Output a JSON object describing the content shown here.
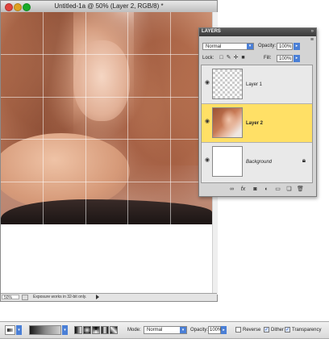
{
  "document": {
    "title": "Untitled-1a @ 50% (Layer 2, RGB/8) *",
    "status": {
      "zoom": "50%",
      "message": "Exposure works in 32-bit only."
    }
  },
  "layers_panel": {
    "title": "LAYERS",
    "blend_mode": "Normal",
    "opacity_label": "Opacity:",
    "opacity_value": "100%",
    "lock_label": "Lock:",
    "fill_label": "Fill:",
    "fill_value": "100%",
    "layers": [
      {
        "name": "Layer 1",
        "selected": false,
        "thumbnail": "transparent",
        "visible": true
      },
      {
        "name": "Layer 2",
        "selected": true,
        "thumbnail": "photo",
        "visible": true
      },
      {
        "name": "Background",
        "selected": false,
        "thumbnail": "white",
        "visible": true,
        "locked": true
      }
    ],
    "footer_icons": [
      "link-icon",
      "fx-icon",
      "mask-icon",
      "adjustment-icon",
      "group-icon",
      "new-layer-icon",
      "trash-icon"
    ]
  },
  "options_bar": {
    "mode_label": "Mode:",
    "mode_value": "Normal",
    "opacity_label": "Opacity:",
    "opacity_value": "100%",
    "reverse_label": "Reverse",
    "reverse_checked": false,
    "dither_label": "Dither",
    "dither_checked": true,
    "transparency_label": "Transparency",
    "transparency_checked": true
  },
  "colors": {
    "selected_layer": "#ffe066",
    "accent_blue": "#4a7fd6"
  }
}
